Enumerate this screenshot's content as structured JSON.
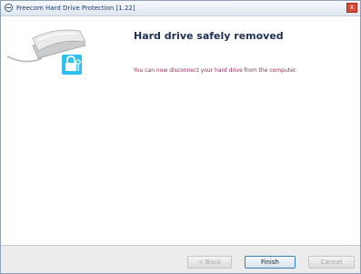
{
  "window": {
    "title": "Freecom Hard Drive Protection [1.22]",
    "close_glyph": "x"
  },
  "icons": {
    "app_icon": "app-icon",
    "drive_illustration": "hard-drive-lock-icon",
    "close_icon": "close-icon"
  },
  "main": {
    "heading": "Hard drive safely removed",
    "message": "You can now disconnect your hard drive from the computer."
  },
  "buttons": {
    "back": "< Back",
    "finish": "Finish",
    "cancel": "Cancel"
  },
  "colors": {
    "heading": "#1f2f52",
    "message": "#8e2d57",
    "lock_badge": "#2fc0ef",
    "finish_border": "#3c7fb1"
  }
}
